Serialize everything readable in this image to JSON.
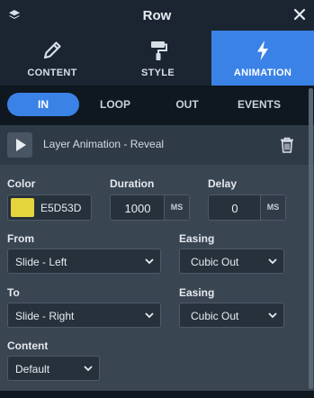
{
  "window": {
    "title": "Row",
    "logo_icon": "layers-icon",
    "close_icon": "close-icon"
  },
  "main_tabs": [
    {
      "label": "CONTENT",
      "icon": "pencil-icon",
      "active": false
    },
    {
      "label": "STYLE",
      "icon": "paint-roller-icon",
      "active": false
    },
    {
      "label": "ANIMATION",
      "icon": "lightning-icon",
      "active": true
    }
  ],
  "sub_tabs": [
    {
      "label": "IN",
      "active": true
    },
    {
      "label": "LOOP",
      "active": false
    },
    {
      "label": "OUT",
      "active": false
    },
    {
      "label": "EVENTS",
      "active": false
    }
  ],
  "layer": {
    "title": "Layer Animation - Reveal",
    "play_icon": "play-icon",
    "delete_icon": "trash-icon"
  },
  "form": {
    "color": {
      "label": "Color",
      "value": "E5D53D",
      "swatch": "#E5D53D"
    },
    "duration": {
      "label": "Duration",
      "value": "1000",
      "unit": "MS"
    },
    "delay": {
      "label": "Delay",
      "value": "0",
      "unit": "MS"
    },
    "from": {
      "label": "From",
      "value": "Slide - Left"
    },
    "easing_in": {
      "label": "Easing",
      "value": "Cubic Out"
    },
    "to": {
      "label": "To",
      "value": "Slide - Right"
    },
    "easing_out": {
      "label": "Easing",
      "value": "Cubic Out"
    },
    "content": {
      "label": "Content",
      "value": "Default"
    }
  },
  "colors": {
    "accent": "#3B82E6",
    "background": "#0F1720",
    "form_bg": "#3A4552"
  }
}
